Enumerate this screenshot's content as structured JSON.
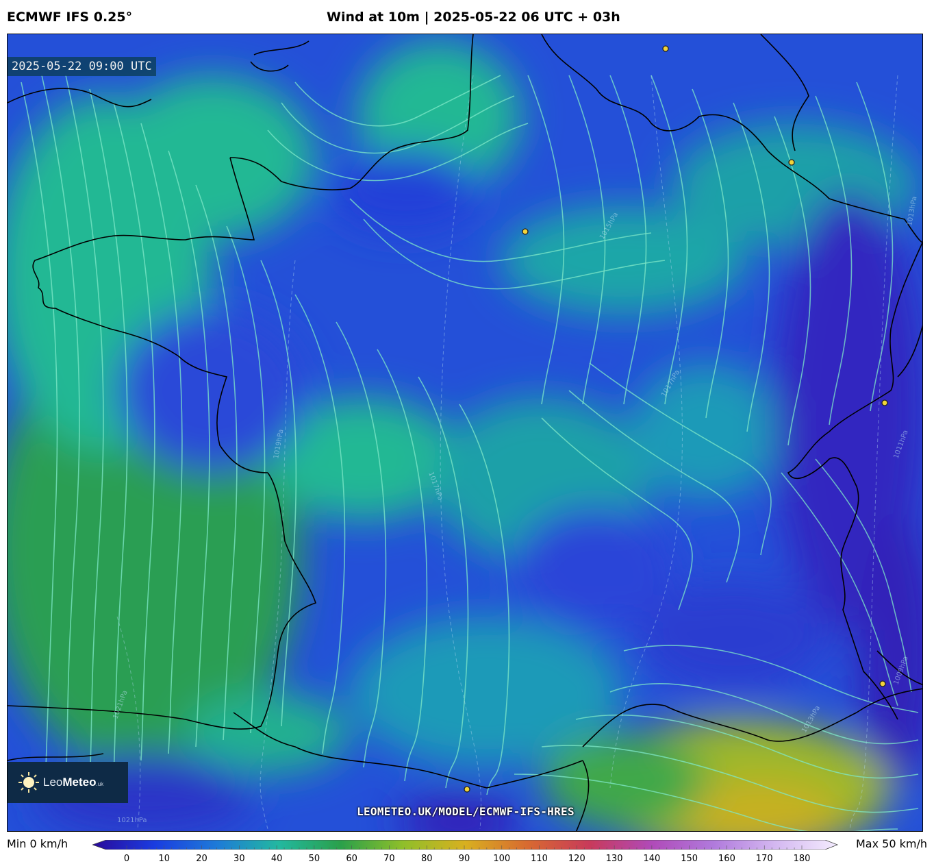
{
  "header": {
    "model": "ECMWF IFS 0.25°",
    "title": "Wind at 10m | 2025-05-22 06 UTC + 03h"
  },
  "map": {
    "valid_time": "2025-05-22 09:00 UTC",
    "watermark": "LEOMETEO.UK/MODEL/ECMWF-IFS-HRES",
    "logo": {
      "name": "Leo",
      "name_bold": "Meteo",
      "suffix": ".uk"
    },
    "isobar_labels": [
      "1021hPa",
      "1021hPa",
      "1017hPa",
      "1019hPa",
      "1017hPa",
      "1015hPa",
      "1013hPa",
      "1011hPa",
      "1009hPa",
      "1013hPa"
    ]
  },
  "legend": {
    "min_label": "Min 0 km/h",
    "max_label": "Max 50 km/h",
    "ticks": [
      "0",
      "10",
      "20",
      "30",
      "40",
      "50",
      "60",
      "70",
      "80",
      "90",
      "100",
      "110",
      "120",
      "130",
      "140",
      "150",
      "160",
      "170",
      "180"
    ],
    "unit": "km/h",
    "colors": [
      "#2a0a9a",
      "#1a3ce0",
      "#1e7ad8",
      "#22b8a0",
      "#2aa04a",
      "#8fbf2a",
      "#d8b020",
      "#d86a30",
      "#c83a5a",
      "#b04ab8",
      "#b07adc",
      "#d4b8f0",
      "#f4ecff"
    ]
  },
  "colors": {
    "calm": "#2a44d8",
    "light": "#1e8ad8",
    "moderate": "#22b894",
    "strong": "#2ea04a",
    "strongest": "#b8b020",
    "streamline": "#7fe8c8",
    "coastline": "#000000",
    "city_marker": "#f2d43a"
  }
}
